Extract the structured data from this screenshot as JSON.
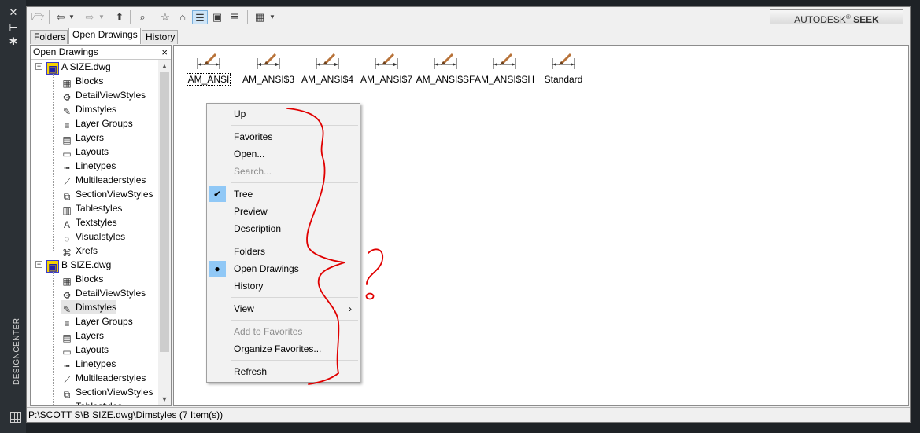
{
  "palette": {
    "title": "DESIGNCENTER"
  },
  "toolbar": {
    "seek_brand": "AUTODESK",
    "seek_reg": "®",
    "seek_word": "SEEK"
  },
  "tabs": [
    {
      "label": "Folders"
    },
    {
      "label": "Open Drawings"
    },
    {
      "label": "History"
    }
  ],
  "tree": {
    "header": "Open Drawings",
    "close": "×",
    "drawings": [
      {
        "label": "A SIZE.dwg",
        "children": [
          "Blocks",
          "DetailViewStyles",
          "Dimstyles",
          "Layer Groups",
          "Layers",
          "Layouts",
          "Linetypes",
          "Multileaderstyles",
          "SectionViewStyles",
          "Tablestyles",
          "Textstyles",
          "Visualstyles",
          "Xrefs"
        ]
      },
      {
        "label": "B SIZE.dwg",
        "children": [
          "Blocks",
          "DetailViewStyles",
          "Dimstyles",
          "Layer Groups",
          "Layers",
          "Layouts",
          "Linetypes",
          "Multileaderstyles",
          "SectionViewStyles",
          "Tablestyles"
        ]
      }
    ]
  },
  "content": {
    "items": [
      "AM_ANSI",
      "AM_ANSI$3",
      "AM_ANSI$4",
      "AM_ANSI$7",
      "AM_ANSI$SF",
      "AM_ANSI$SH",
      "Standard"
    ]
  },
  "menu": {
    "up": "Up",
    "favorites": "Favorites",
    "open": "Open...",
    "search": "Search...",
    "tree": "Tree",
    "preview": "Preview",
    "description": "Description",
    "folders": "Folders",
    "open_drawings": "Open Drawings",
    "history": "History",
    "view": "View",
    "add_favorites": "Add to Favorites",
    "organize_favorites": "Organize Favorites...",
    "refresh": "Refresh"
  },
  "status": {
    "text": "P:\\SCOTT S\\B SIZE.dwg\\Dimstyles (7 Item(s))"
  },
  "colors": {
    "annotation": "#e00000",
    "checked_bg": "#90c8f6"
  }
}
